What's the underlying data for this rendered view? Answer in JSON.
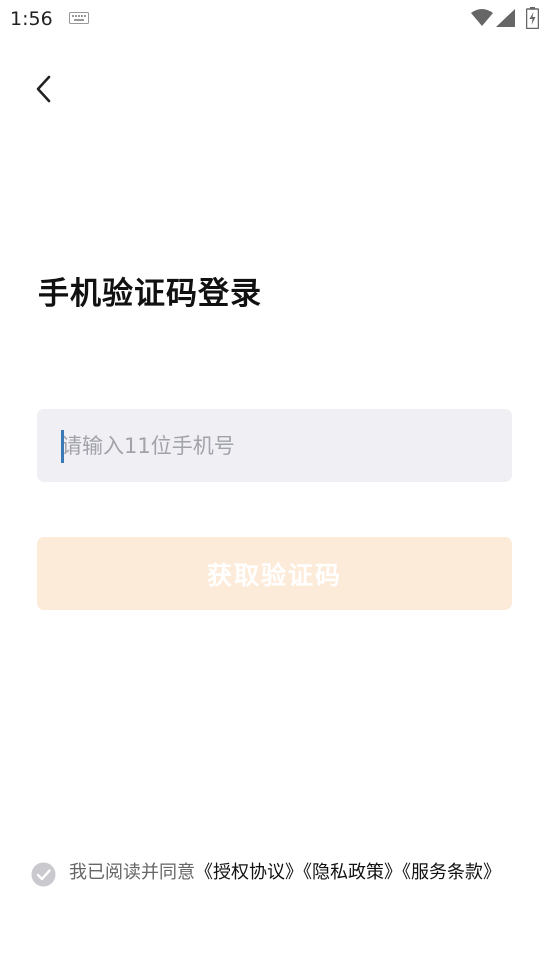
{
  "status_bar": {
    "time": "1:56",
    "icons": [
      "keyboard-icon",
      "wifi-icon",
      "cell-signal-icon",
      "battery-charging-icon"
    ]
  },
  "nav": {
    "back_icon": "chevron-left-icon"
  },
  "title": "手机验证码登录",
  "phone": {
    "placeholder": "请输入11位手机号",
    "value": ""
  },
  "get_code_button": {
    "label": "获取验证码",
    "enabled": false
  },
  "agreement": {
    "checked": false,
    "prefix": "我已阅读并同意",
    "links": [
      "《授权协议》",
      "《隐私政策》",
      "《服务条款》"
    ]
  },
  "colors": {
    "button_disabled_bg": "#fdebd9",
    "input_bg": "#efeff4",
    "caret": "#3b78b6",
    "check_gray": "#c9c9ce"
  }
}
